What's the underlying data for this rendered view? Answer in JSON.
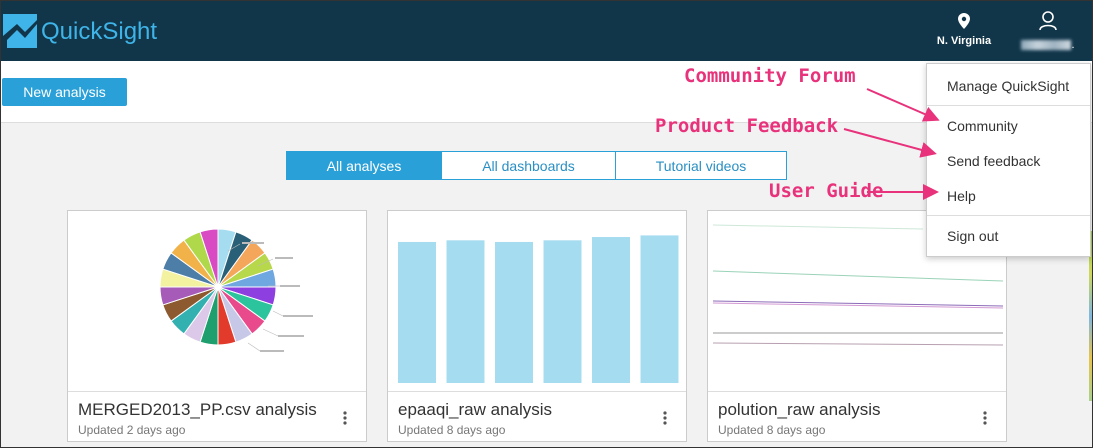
{
  "header": {
    "brand": "QuickSight",
    "region": "N. Virginia",
    "user_suffix": "."
  },
  "toolbar": {
    "new_analysis": "New analysis"
  },
  "tabs": [
    {
      "label": "All analyses",
      "active": true
    },
    {
      "label": "All dashboards",
      "active": false
    },
    {
      "label": "Tutorial videos",
      "active": false
    }
  ],
  "cards": [
    {
      "title": "MERGED2013_PP.csv analysis",
      "updated": "Updated 2 days ago",
      "thumbnail": "pie-chart"
    },
    {
      "title": "epaaqi_raw analysis",
      "updated": "Updated 8 days ago",
      "thumbnail": "bar-chart",
      "bars": [
        0.86,
        0.87,
        0.86,
        0.87,
        0.89,
        0.9
      ]
    },
    {
      "title": "polution_raw analysis",
      "updated": "Updated 8 days ago",
      "thumbnail": "line-chart"
    }
  ],
  "menu": {
    "items": [
      "Manage QuickSight",
      "Community",
      "Send feedback",
      "Help",
      "Sign out"
    ]
  },
  "annotations": {
    "community": "Community Forum",
    "feedback": "Product Feedback",
    "guide": "User Guide"
  },
  "colors": {
    "topbar": "#11364a",
    "brand": "#3fb4e8",
    "accent": "#2aa0d8",
    "annotation": "#e8327b",
    "bar": "#a5dcef"
  }
}
